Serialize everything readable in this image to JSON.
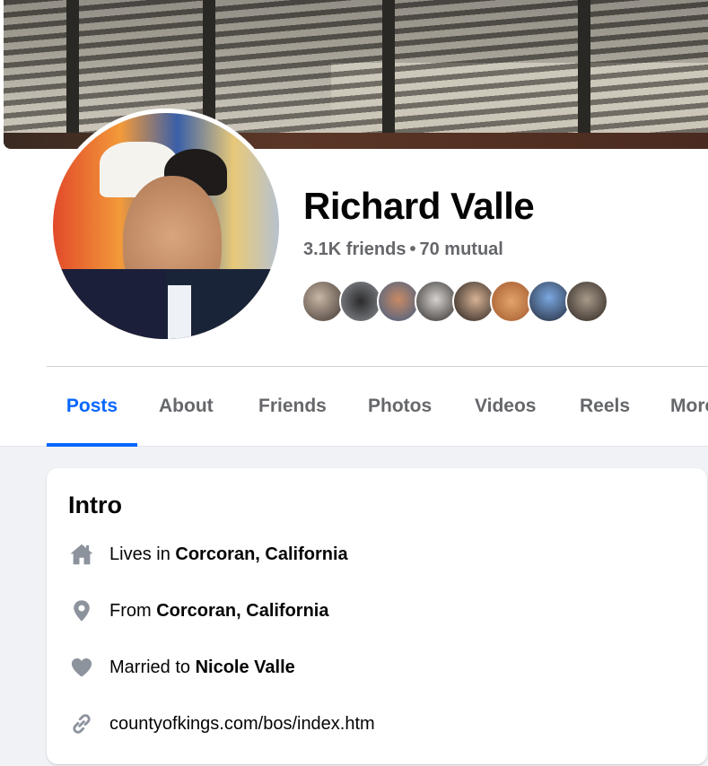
{
  "profile": {
    "name": "Richard Valle",
    "friends_count": "3.1K friends",
    "separator": "•",
    "mutual_count": "70 mutual",
    "mutual_friend_avatars": 8
  },
  "tabs": [
    {
      "label": "Posts",
      "active": true
    },
    {
      "label": "About",
      "active": false
    },
    {
      "label": "Friends",
      "active": false
    },
    {
      "label": "Photos",
      "active": false
    },
    {
      "label": "Videos",
      "active": false
    },
    {
      "label": "Reels",
      "active": false
    },
    {
      "label": "More",
      "active": false
    }
  ],
  "intro": {
    "title": "Intro",
    "lives_prefix": "Lives in",
    "lives_value": "Corcoran, California",
    "from_prefix": "From",
    "from_value": "Corcoran, California",
    "married_prefix": "Married to",
    "married_value": "Nicole Valle",
    "website": "countyofkings.com/bos/index.htm"
  },
  "icons": {
    "home": "home-icon",
    "location": "location-pin-icon",
    "relationship": "heart-icon",
    "link": "link-icon"
  },
  "colors": {
    "accent": "#0866ff",
    "secondary_text": "#65676b",
    "icon_gray": "#8c939d"
  }
}
